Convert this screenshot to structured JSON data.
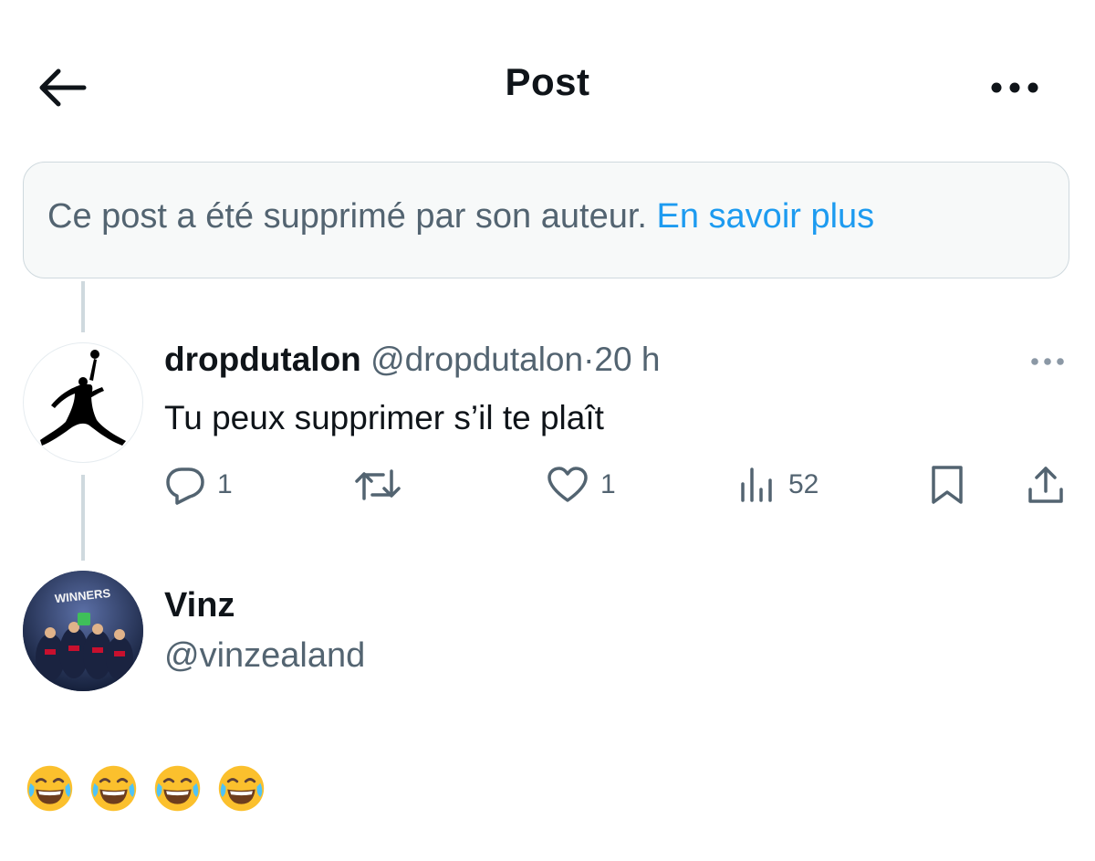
{
  "header": {
    "title": "Post",
    "back_icon": "arrow-left-icon",
    "more_icon": "more-dots-icon"
  },
  "deleted_notice": {
    "text": "Ce post a été supprimé par son auteur.",
    "link": "En savoir plus"
  },
  "reply": {
    "display_name": "dropdutalon",
    "handle": "@dropdutalon",
    "separator": "·",
    "time": "20 h",
    "text": "Tu peux supprimer s’il te plaît",
    "actions": {
      "reply_count": "1",
      "repost_count": "",
      "like_count": "1",
      "views_count": "52"
    }
  },
  "main_post": {
    "display_name": "Vinz",
    "handle": "@vinzealand",
    "text": "😂😂😂😂",
    "avatar_text": "WINNERS"
  },
  "colors": {
    "accent": "#1d9bf0",
    "muted": "#536471",
    "border": "#cfd9de",
    "text": "#0f1419"
  }
}
